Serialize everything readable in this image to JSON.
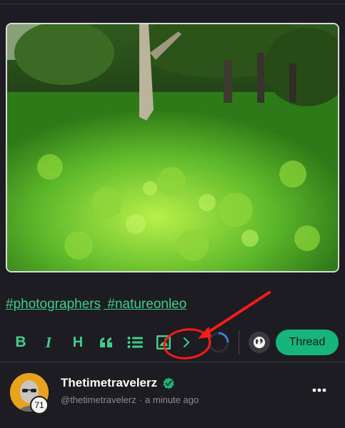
{
  "post": {
    "hashtags": [
      "#photographers",
      "#natureonleo"
    ],
    "image_alt": "Green forest floor with tree trunks"
  },
  "toolbar": {
    "items": [
      {
        "icon": "bold-icon",
        "label": "B"
      },
      {
        "icon": "italic-icon",
        "label": "I"
      },
      {
        "icon": "heading-icon",
        "label": "H"
      },
      {
        "icon": "quote-icon"
      },
      {
        "icon": "list-icon"
      },
      {
        "icon": "image-icon"
      },
      {
        "icon": "chevron-right-icon"
      }
    ],
    "thread_label": "Thread"
  },
  "author": {
    "name": "Thetimetravelerz",
    "handle": "@thetimetravelerz",
    "separator": "·",
    "time": "a minute ago",
    "reputation": "71"
  },
  "colors": {
    "accent": "#3ecf8e",
    "thread_button": "#17b47d",
    "background": "#1c1c21",
    "annotation": "#ff1a1a"
  }
}
